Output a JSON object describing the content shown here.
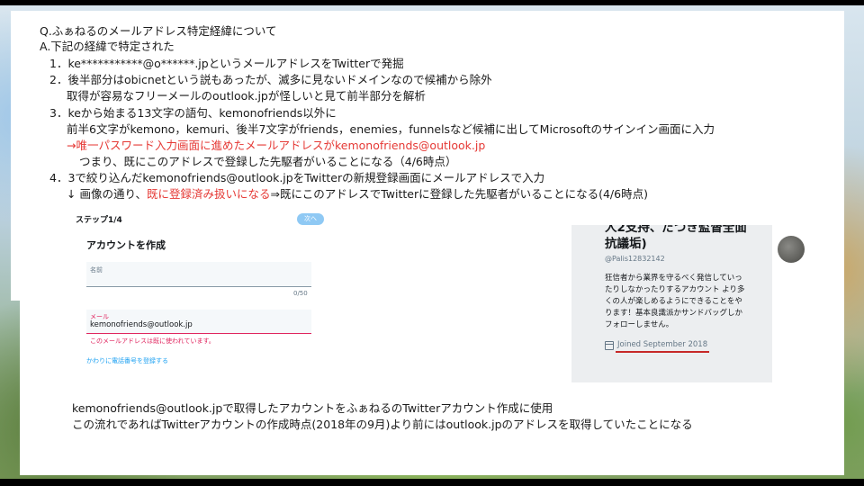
{
  "doc": {
    "lines": [
      "Q.ふぁねるのメールアドレス特定経緯について",
      "A.下記の経緯で特定された",
      "1．ke***********@o******.jpというメールアドレスをTwitterで発掘",
      "2．後半部分はobicnetという説もあったが、滅多に見ないドメインなので候補から除外",
      "取得が容易なフリーメールのoutlook.jpが怪しいと見て前半部分を解析",
      "3．keから始まる13文字の語句、kemonofriends以外に",
      "前半6文字がkemono，kemuri、後半7文字がfriends，enemies，funnelsなど候補に出してMicrosoftのサインイン画面に入力",
      "→唯一パスワード入力画面に進めたメールアドレスがkemonofriends@outlook.jp",
      "つまり、既にこのアドレスで登録した先駆者がいることになる（4/6時点）",
      "4．3で絞り込んだkemonofriends@outlook.jpをTwitterの新規登録画面にメールアドレスで入力",
      "↓ 画像の通り、",
      "既に登録済み扱いになる",
      "⇒既にこのアドレスでTwitterに登録した先駆者がいることになる(4/6時点)"
    ],
    "footer": [
      "kemonofriends@outlook.jpで取得したアカウントをふぁねるのTwitterアカウント作成に使用",
      "この流れであればTwitterアカウントの作成時点(2018年の9月)より前にはoutlook.jpのアドレスを取得していたことになる"
    ]
  },
  "signup": {
    "step": "ステップ1/4",
    "next_label": "次へ",
    "title": "アカウントを作成",
    "name_label": "名前",
    "name_count": "0/50",
    "mail_label": "メール",
    "mail_value": "kemonofriends@outlook.jp",
    "mail_error": "このメールアドレスは既に使われています。",
    "phone_link": "かわりに電話番号を登録する"
  },
  "profile": {
    "name_line1": "人2支持、だつき監督全面",
    "name_line2": "抗議垢)",
    "handle": "@Palis12832142",
    "bio": [
      "狂信者から業界を守るべく発信していっ",
      "たりしなかったりするアカウント より多",
      "くの人が楽しめるようにできることをや",
      "ります！基本良識派かサンドバッグしか",
      "フォローしません。"
    ],
    "joined": "Joined September 2018"
  }
}
